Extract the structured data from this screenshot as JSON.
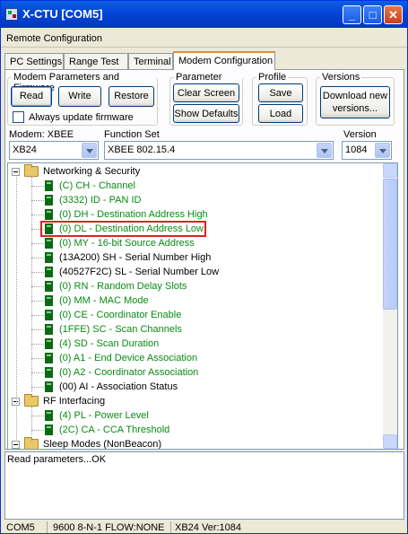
{
  "window": {
    "title": "X-CTU  [COM5]",
    "minimize": "_",
    "maximize": "□",
    "close": "✕"
  },
  "menu": {
    "label": "Remote Configuration"
  },
  "tabs": [
    "PC Settings",
    "Range Test",
    "Terminal",
    "Modem Configuration"
  ],
  "groups": {
    "modem": {
      "label": "Modem Parameters and Firmware",
      "read": "Read",
      "write": "Write",
      "restore": "Restore",
      "always_update": "Always update firmware"
    },
    "paramview": {
      "label": "Parameter View",
      "clear": "Clear Screen",
      "defaults": "Show Defaults"
    },
    "profile": {
      "label": "Profile",
      "save": "Save",
      "load": "Load"
    },
    "versions": {
      "label": "Versions",
      "download": "Download new versions..."
    }
  },
  "selectors": {
    "modem_label": "Modem: XBEE",
    "modem_value": "XB24",
    "function_label": "Function Set",
    "function_value": "XBEE 802.15.4",
    "version_label": "Version",
    "version_value": "1084"
  },
  "tree": {
    "networking": "Networking & Security",
    "items": [
      {
        "text": "(C) CH - Channel",
        "green": true
      },
      {
        "text": "(3332) ID - PAN ID",
        "green": true
      },
      {
        "text": "(0) DH - Destination Address High",
        "green": true
      },
      {
        "text": "(0) DL - Destination Address Low",
        "green": true
      },
      {
        "text": "(0) MY - 16-bit Source Address",
        "green": true
      },
      {
        "text": "(13A200) SH - Serial Number High",
        "green": false
      },
      {
        "text": "(40527F2C) SL - Serial Number Low",
        "green": false
      },
      {
        "text": "(0) RN - Random Delay Slots",
        "green": true
      },
      {
        "text": "(0) MM - MAC Mode",
        "green": true
      },
      {
        "text": "(0) CE - Coordinator Enable",
        "green": true
      },
      {
        "text": "(1FFE) SC - Scan Channels",
        "green": true
      },
      {
        "text": "(4) SD - Scan Duration",
        "green": true
      },
      {
        "text": "(0) A1 - End Device Association",
        "green": true
      },
      {
        "text": "(0) A2 - Coordinator Association",
        "green": true
      },
      {
        "text": "(00) AI - Association Status",
        "green": false
      }
    ],
    "rf": "RF Interfacing",
    "rf_items": [
      {
        "text": "(4) PL - Power Level",
        "green": true
      },
      {
        "text": "(2C) CA - CCA Threshold",
        "green": true
      }
    ],
    "sleep": "Sleep Modes (NonBeacon)"
  },
  "status_text": "Read parameters...OK",
  "statusbar": {
    "port": "COM5",
    "settings": "9600 8-N-1  FLOW:NONE",
    "device": "XB24  Ver:1084"
  }
}
